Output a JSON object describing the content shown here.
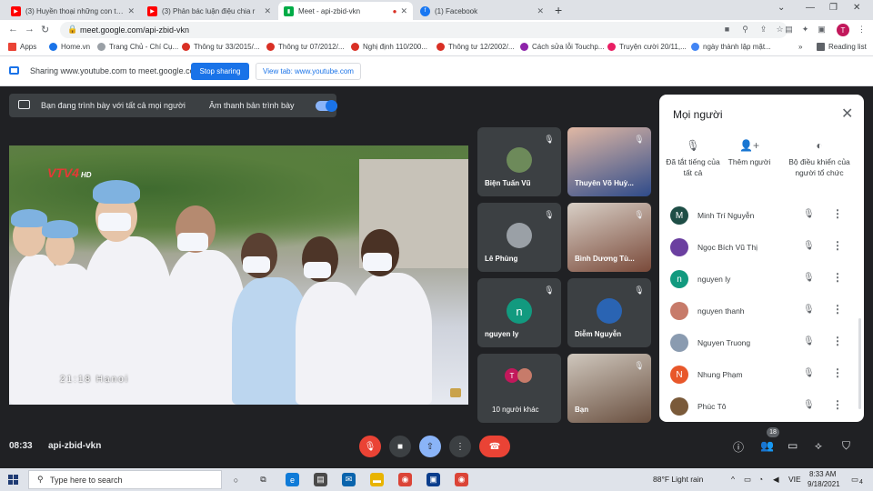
{
  "browser": {
    "tabs": [
      {
        "title": "(3) Huyền thoại những con tàu kh",
        "color": "#ff0000"
      },
      {
        "title": "(3) Phản bác luận điệu chia r",
        "color": "#ff0000"
      },
      {
        "title": "Meet - api-zbid-vkn",
        "color": "#00ac47",
        "active": true
      },
      {
        "title": "(1) Facebook",
        "color": "#1877f2"
      }
    ],
    "url": "meet.google.com/api-zbid-vkn",
    "profile_initial": "T",
    "bookmarks": [
      {
        "label": "Apps",
        "color": "#ea4335"
      },
      {
        "label": "Home.vn",
        "color": "#1a73e8"
      },
      {
        "label": "Trang Chủ - Chí Cụ...",
        "color": "#9aa0a6"
      },
      {
        "label": "Thông tư 33/2015/...",
        "color": "#d93025"
      },
      {
        "label": "Thông tư 07/2012/...",
        "color": "#d93025"
      },
      {
        "label": "Nghị định 110/200...",
        "color": "#d93025"
      },
      {
        "label": "Thông tư 12/2002/...",
        "color": "#d93025"
      },
      {
        "label": "Cách sửa lỗi Touchp...",
        "color": "#8e24aa"
      },
      {
        "label": "Truyện cười 20/11,...",
        "color": "#e91e63"
      },
      {
        "label": "ngày thành lập mặt...",
        "color": "#4285f4"
      }
    ],
    "reading_list": "Reading list"
  },
  "sharing_bar": {
    "text": "Sharing www.youtube.com to meet.google.com",
    "stop_label": "Stop sharing",
    "view_label": "View tab: www.youtube.com"
  },
  "meet": {
    "present_text": "Bạn đang trình bày với tất cả mọi người",
    "audio_text": "Âm thanh bản trình bày",
    "video_logo": "VTV4",
    "video_hd": "HD",
    "video_clock": "21:18 Hanoi",
    "tiles": [
      {
        "name": "Biện Tuấn Vũ",
        "kind": "avatar-photo"
      },
      {
        "name": "Thuyên Võ Huỳ...",
        "kind": "photo"
      },
      {
        "name": "Lê Phùng",
        "kind": "avatar-photo"
      },
      {
        "name": "Bình Dương Tù...",
        "kind": "photo"
      },
      {
        "name": "nguyen ly",
        "kind": "letter",
        "letter": "n",
        "color": "#129a7f"
      },
      {
        "name": "Diễm Nguyễn",
        "kind": "avatar-photo"
      },
      {
        "name": "10 người khác",
        "kind": "others"
      },
      {
        "name": "Bạn",
        "kind": "photo"
      }
    ],
    "time": "08:33",
    "meeting_code": "api-zbid-vkn",
    "participants_count": "18"
  },
  "people_panel": {
    "title": "Mọi người",
    "actions": [
      {
        "label": "Đã tắt tiếng của tất cả",
        "icon": "mic-off-icon"
      },
      {
        "label": "Thêm người",
        "icon": "add-person-icon"
      },
      {
        "label": "Bộ điều khiển của người tổ chức",
        "icon": "toggle-icon"
      }
    ],
    "people": [
      {
        "name": "Minh Trí Nguyễn",
        "initial": "M",
        "color": "#1e4e46"
      },
      {
        "name": "Ngọc Bích Vũ Thị",
        "initial": "",
        "color": "#6b3fa0"
      },
      {
        "name": "nguyen ly",
        "initial": "n",
        "color": "#129a7f"
      },
      {
        "name": "nguyen thanh",
        "initial": "",
        "color": "#c77b6a"
      },
      {
        "name": "Nguyen Truong",
        "initial": "",
        "color": "#8a9bb0"
      },
      {
        "name": "Nhung Phạm",
        "initial": "N",
        "color": "#e8572a"
      },
      {
        "name": "Phúc Tô",
        "initial": "",
        "color": "#7a5a3a"
      }
    ]
  },
  "taskbar": {
    "search_placeholder": "Type here to search",
    "weather": "88°F  Light rain",
    "lang": "VIE",
    "time": "8:33 AM",
    "date": "9/18/2021",
    "notifications": "4"
  }
}
